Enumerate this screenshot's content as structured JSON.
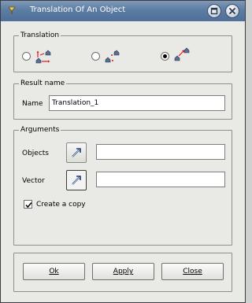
{
  "window": {
    "title": "Translation Of An Object"
  },
  "translation_group": {
    "legend": "Translation",
    "options": [
      {
        "name": "translation-by-dx-dy-dz",
        "checked": false
      },
      {
        "name": "translation-by-two-points",
        "checked": false
      },
      {
        "name": "translation-by-vector",
        "checked": true
      }
    ]
  },
  "result_group": {
    "legend": "Result name",
    "name_label": "Name",
    "name_value": "Translation_1"
  },
  "arguments_group": {
    "legend": "Arguments",
    "objects_label": "Objects",
    "objects_value": "",
    "vector_label": "Vector",
    "vector_value": "",
    "copy_label": "Create a copy",
    "copy_checked": true
  },
  "buttons": {
    "ok_label": "Ok",
    "apply_label": "Apply",
    "close_label": "Close"
  },
  "colors": {
    "title_gradient_top": "#7f98b6",
    "title_gradient_bottom": "#4f6f98",
    "dialog_bg": "#e9e9e6",
    "arrow_red": "#e01818"
  }
}
